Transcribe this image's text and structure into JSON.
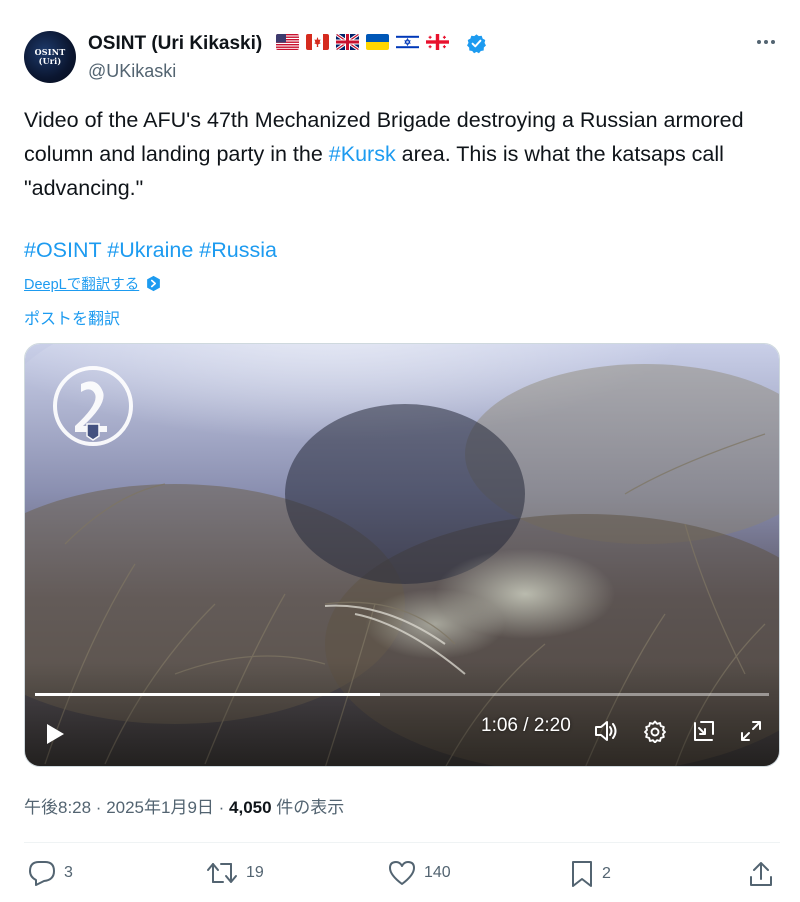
{
  "author": {
    "avatar_text": "OSINT (Uri)",
    "name": "OSINT (Uri Kikaski)",
    "handle": "@UKikaski",
    "flags": [
      "flag-us-icon",
      "flag-ca-icon",
      "flag-gb-icon",
      "flag-ua-icon",
      "flag-il-icon",
      "flag-ge-icon"
    ]
  },
  "tweet": {
    "text_before": "Video of the AFU's 47th Mechanized Brigade destroying a Russian armored column and landing party in the ",
    "text_link": "#Kursk",
    "text_after": " area. This is what the katsaps call \"advancing.\"",
    "hashtags": [
      "#OSINT",
      "#Ukraine",
      "#Russia"
    ]
  },
  "translation": {
    "deepl_label": "DeepLで翻訳する",
    "translate_label": "ポストを翻訳"
  },
  "video": {
    "time": "1:06 / 2:20",
    "progress": 0.47
  },
  "meta": {
    "timestamp": "午後8:28 · 2025年1月9日 · ",
    "views": "4,050",
    "views_suffix": " 件の表示"
  },
  "actions": {
    "replies": "3",
    "reposts": "19",
    "likes": "140",
    "bookmarks": "2"
  },
  "colors": {
    "accent": "#1d9bf0",
    "text_secondary": "#536471"
  }
}
